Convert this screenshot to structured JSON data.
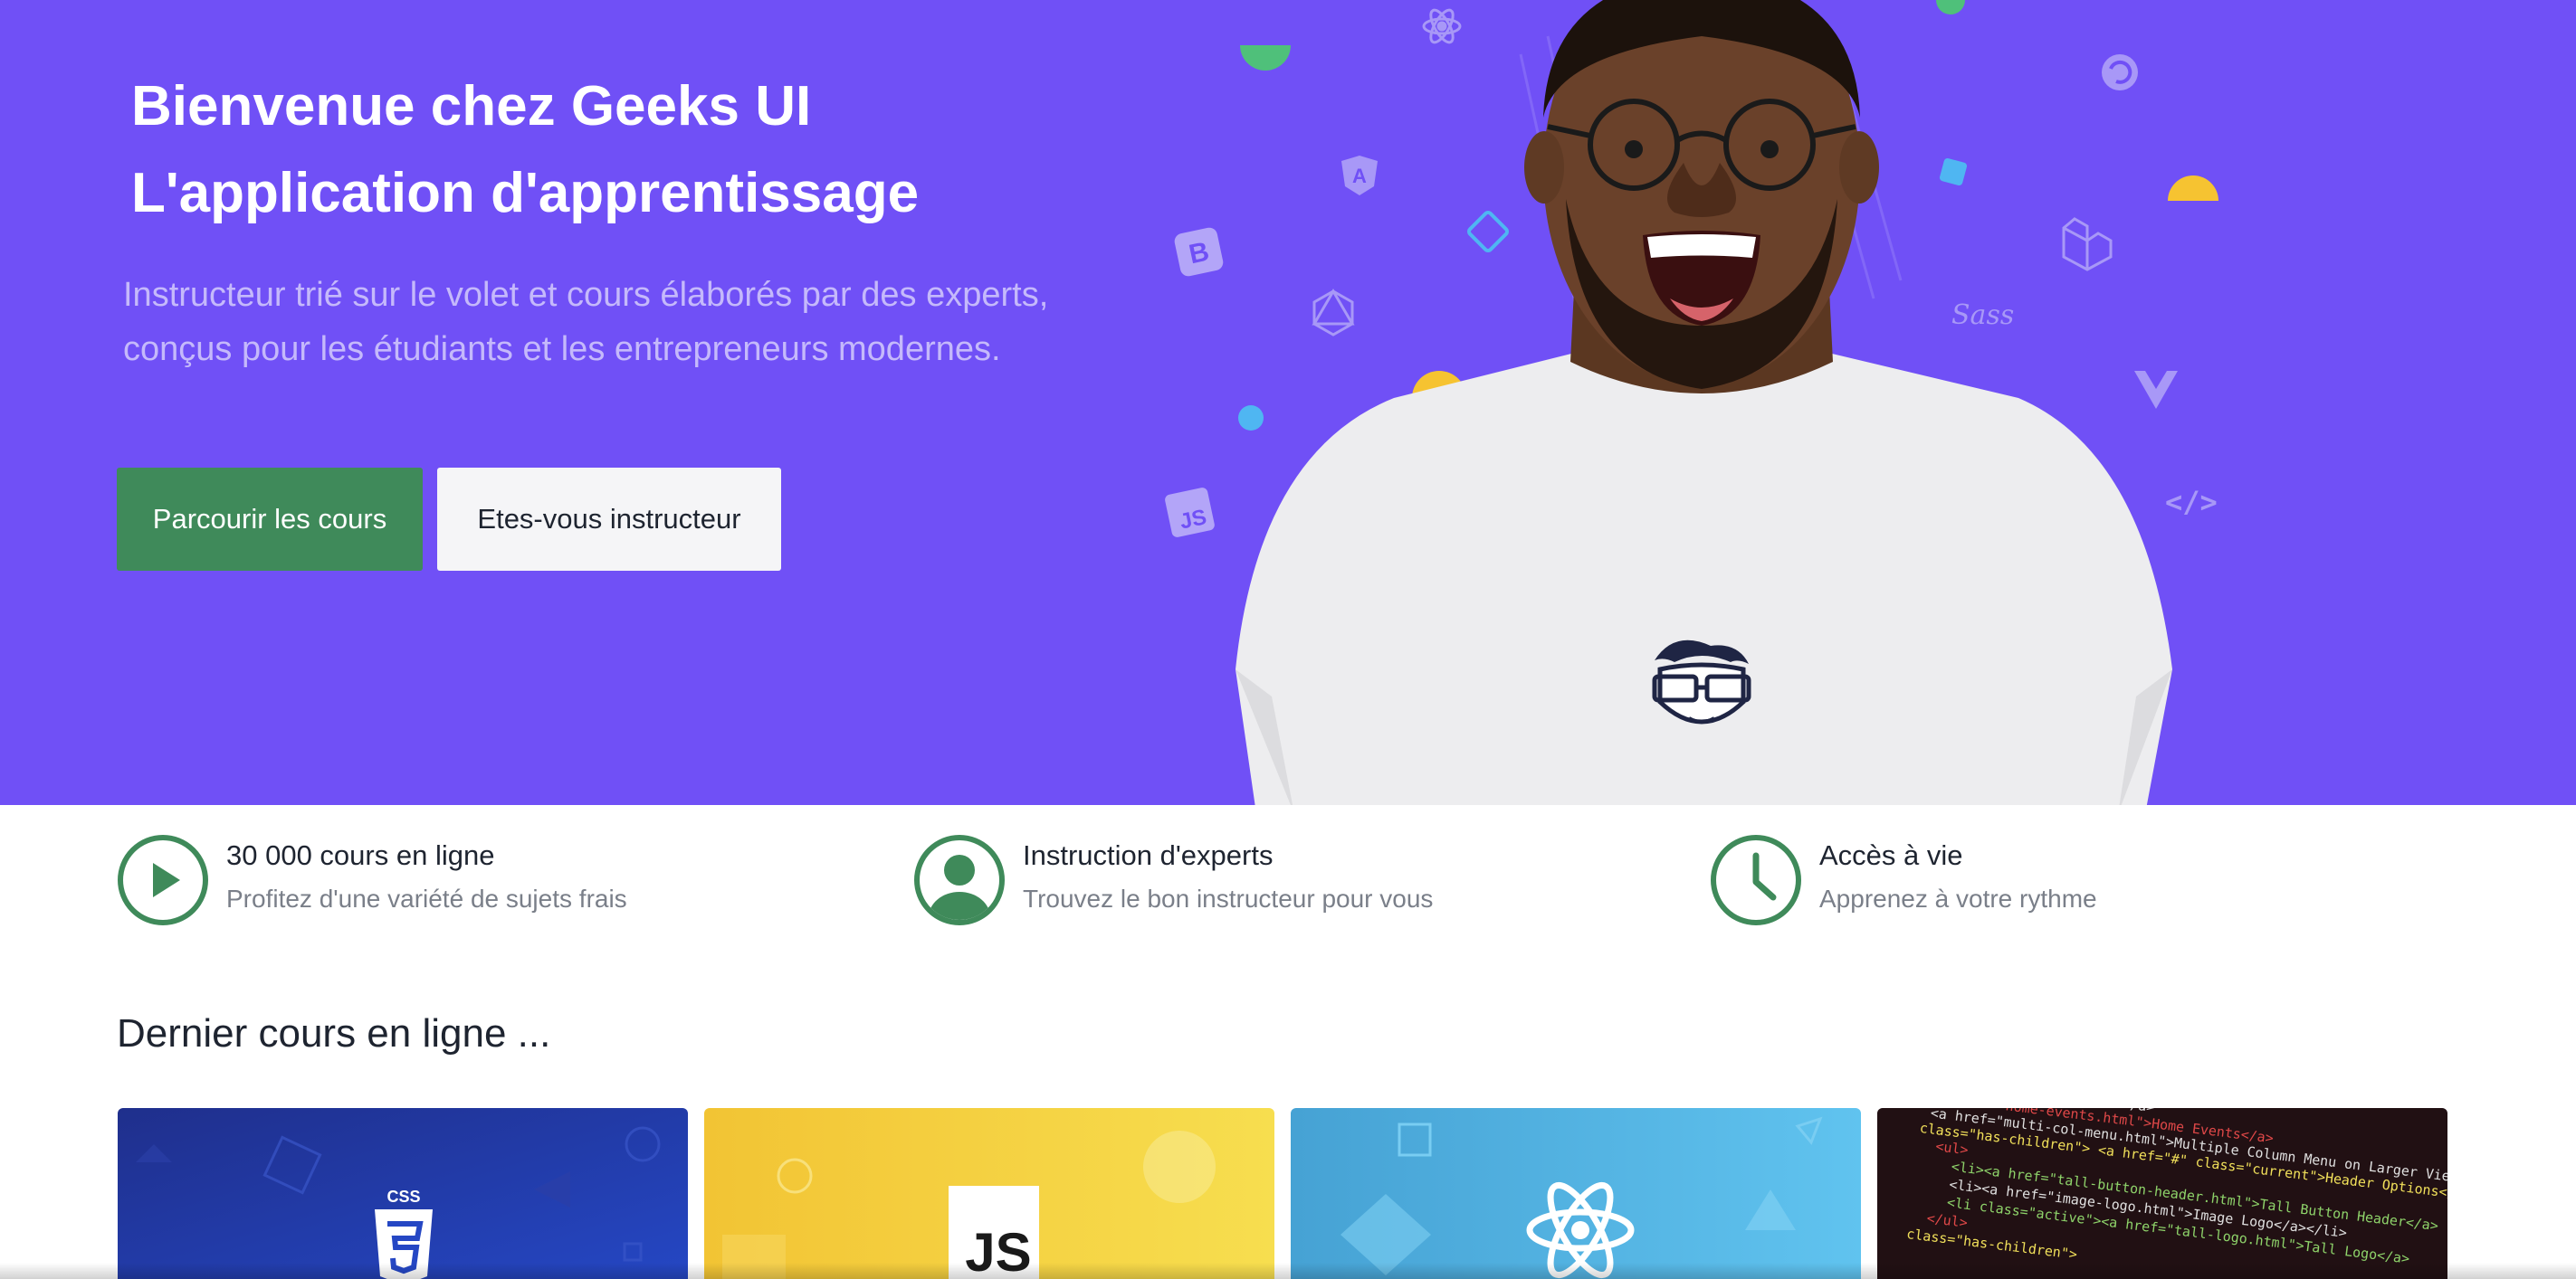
{
  "hero": {
    "title_line1": "Bienvenue chez Geeks UI",
    "title_line2": "L'application d'apprentissage",
    "subtitle": "Instructeur trié sur le volet et cours élaborés par des experts, conçus pour les étudiants et les entrepreneurs modernes.",
    "primary_button": "Parcourir les cours",
    "secondary_button": "Etes-vous instructeur",
    "colors": {
      "background": "#7050f6",
      "primary_button": "#3f8a5a"
    },
    "floating_icons": [
      "react-icon",
      "angular-icon",
      "bootstrap-icon",
      "graphql-icon",
      "javascript-icon",
      "laravel-icon",
      "sass-icon",
      "vue-icon",
      "gatsby-icon",
      "code-tag-icon"
    ],
    "code_tag_text": "</>",
    "sass_text": "Sass"
  },
  "features": [
    {
      "icon": "play-circle-icon",
      "title": "30 000 cours en ligne",
      "description": "Profitez d'une variété de sujets frais"
    },
    {
      "icon": "user-circle-icon",
      "title": "Instruction d'experts",
      "description": "Trouvez le bon instructeur pour vous"
    },
    {
      "icon": "clock-icon",
      "title": "Accès à vie",
      "description": "Apprenez à votre rythme"
    }
  ],
  "section": {
    "title": "Dernier cours en ligne ..."
  },
  "courses": [
    {
      "thumbnail": "css3",
      "badge_text": "CSS"
    },
    {
      "thumbnail": "javascript",
      "badge_text": "JS"
    },
    {
      "thumbnail": "react"
    },
    {
      "thumbnail": "html-code"
    }
  ],
  "code_snippet": [
    "href=\"index.html\">Home</a>",
    "<a href=\"home-events.html\">Home Events</a>",
    "<a href=\"multi-col-menu.html\">Multiple Column Menu on Larger Viewports",
    "class=\"has-children\"> <a href=\"#\" class=\"current\">Header Options</a>",
    "<ul>",
    "<li><a href=\"tall-button-header.html\">Tall Button Header</a>",
    "<li><a href=\"image-logo.html\">Image Logo</a></li>",
    "<li class=\"active\"><a href=\"tall-logo.html\">Tall Logo</a>",
    "</ul>",
    "class=\"has-children\">"
  ]
}
